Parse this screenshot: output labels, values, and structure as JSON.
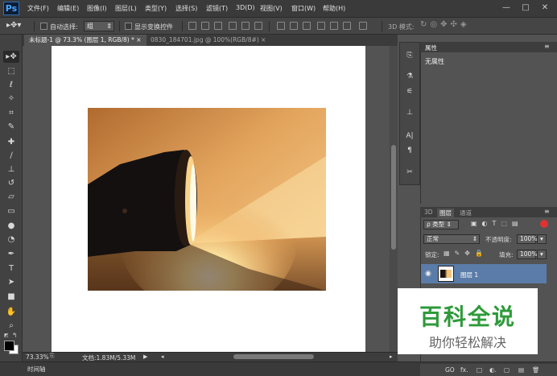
{
  "app": {
    "logo": "Ps"
  },
  "menu": [
    "文件(F)",
    "编辑(E)",
    "图像(I)",
    "图层(L)",
    "类型(Y)",
    "选择(S)",
    "滤镜(T)",
    "3D(D)",
    "视图(V)",
    "窗口(W)",
    "帮助(H)"
  ],
  "window_controls": {
    "minimize": "—",
    "maximize": "□",
    "close": "✕"
  },
  "options": {
    "auto_select_label": "自动选择:",
    "auto_select_value": "组",
    "show_transform_label": "显示变换控件",
    "mode_3d_label": "3D 模式:"
  },
  "tabs": [
    {
      "label": "未标题-1 @ 73.3% (图层 1, RGB/8) *",
      "close": "×"
    },
    {
      "label": "0830_184701.jpg @ 100%(RGB/8#)",
      "close": "×"
    }
  ],
  "status": {
    "zoom": "73.33%",
    "doc_info": "文档:1.83M/5.33M"
  },
  "timeline_label": "时间轴",
  "properties": {
    "title": "属性",
    "empty_text": "无属性"
  },
  "layers": {
    "tabs": [
      "3D",
      "图层",
      "通道"
    ],
    "filter_kind": "ρ 类型",
    "blend_mode": "正常",
    "opacity_label": "不透明度:",
    "opacity_value": "100%",
    "lock_label": "锁定:",
    "fill_label": "填充:",
    "fill_value": "100%",
    "layer_name": "图层 1",
    "bottom_icons": [
      "GO",
      "fx.",
      "□",
      "◐.",
      "▢",
      "▤",
      "🗑"
    ]
  },
  "watermark": {
    "title": "百科全说",
    "subtitle": "助你轻松解决",
    "title_color": "#2e9a3a",
    "subtitle_color": "#666666"
  },
  "colors": {
    "menubar": "#3a3a3a",
    "workspace": "#535353",
    "selected_layer": "#5b7ca8"
  }
}
